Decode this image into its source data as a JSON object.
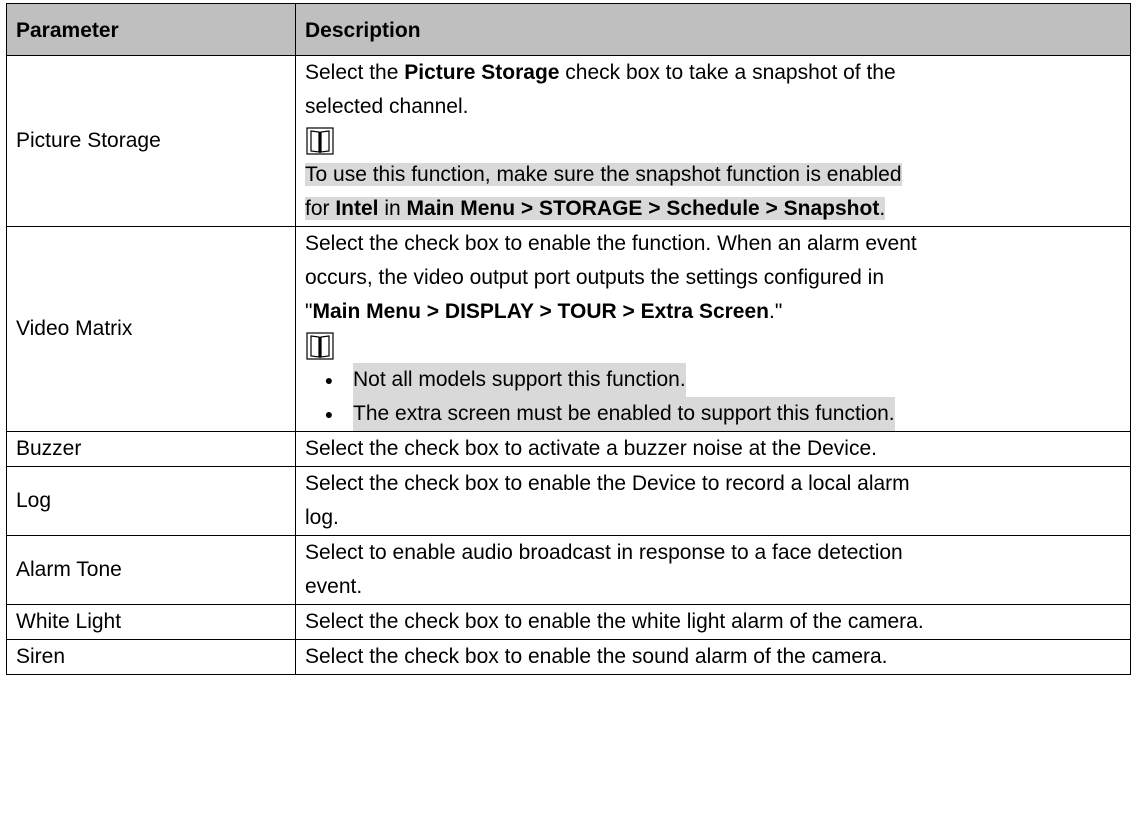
{
  "table": {
    "headers": {
      "parameter": "Parameter",
      "description": "Description"
    },
    "rows": {
      "picture_storage": {
        "param": "Picture Storage",
        "d1": "Select the ",
        "d1b": "Picture Storage",
        "d2": " check box to take a snapshot of the",
        "d3": "selected channel.",
        "note": "To use this function, make sure the snapshot function is enabled",
        "n1": "for ",
        "n1b": "Intel",
        "n2": " in ",
        "n2b": "Main Menu > STORAGE > Schedule > Snapshot",
        "n3": "."
      },
      "video_matrix": {
        "param": "Video Matrix",
        "l1": "Select the check box to enable the function. When an alarm event",
        "l2": "occurs, the video output port outputs the settings configured in",
        "q1": "\"",
        "qb": "Main Menu > DISPLAY > TOUR > Extra Screen",
        "q2": ".\"",
        "bullets": [
          "Not all models support this function.",
          "The extra screen must be enabled to support this function."
        ]
      },
      "buzzer": {
        "param": "Buzzer",
        "desc": "Select the check box to activate a buzzer noise at the Device."
      },
      "log": {
        "param": "Log",
        "l1": "Select the check box to enable the Device to record a local alarm",
        "l2": "log."
      },
      "alarm_tone": {
        "param": "Alarm Tone",
        "l1": "Select to enable audio broadcast in response to a face detection",
        "l2": "event."
      },
      "white_light": {
        "param": "White Light",
        "desc": "Select the check box to enable the white light alarm of the camera."
      },
      "siren": {
        "param": "Siren",
        "desc": "Select the check box to enable the sound alarm of the camera."
      }
    }
  },
  "icons": {
    "note": "book-note-icon",
    "bullet": "bullet-dot-icon"
  },
  "colors": {
    "header_bg": "#bfbfbf",
    "note_highlight": "#d9d9d9",
    "border": "#000000"
  }
}
